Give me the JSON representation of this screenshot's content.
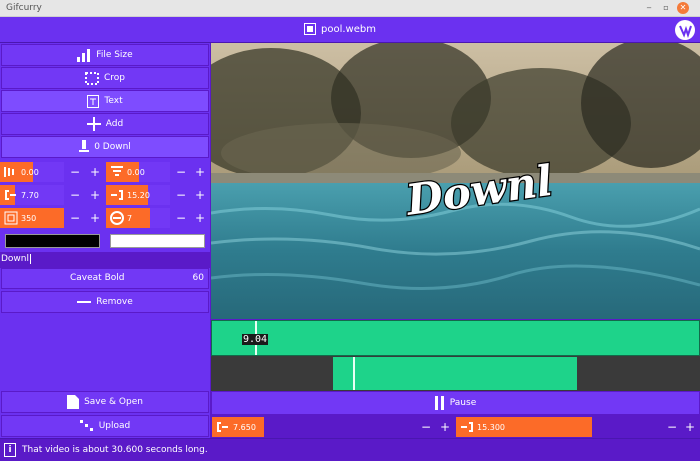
{
  "window": {
    "title": "Gifcurry"
  },
  "header": {
    "file_name": "pool.webm"
  },
  "sidebar": {
    "file_size": "File Size",
    "crop": "Crop",
    "text": "Text",
    "add": "Add",
    "text_item": "0 Downl"
  },
  "text_settings": {
    "x_offset": "0.00",
    "y_offset": "0.00",
    "start": "7.70",
    "end": "15.20",
    "size": "350",
    "outline": "7",
    "fill_color": "#000000",
    "outline_color": "#ffffff",
    "text_value": "Downl",
    "font_name": "Caveat Bold",
    "font_size": "60",
    "remove": "Remove"
  },
  "video": {
    "overlay_text": "Downl"
  },
  "timeline": {
    "current_time": "9.04",
    "trim_start": "7.650",
    "trim_end": "15.300"
  },
  "actions": {
    "save_open": "Save & Open",
    "upload": "Upload",
    "pause": "Pause"
  },
  "status": {
    "message": "That video is about 30.600 seconds long."
  },
  "glyphs": {
    "minus": "−",
    "plus": "+"
  }
}
